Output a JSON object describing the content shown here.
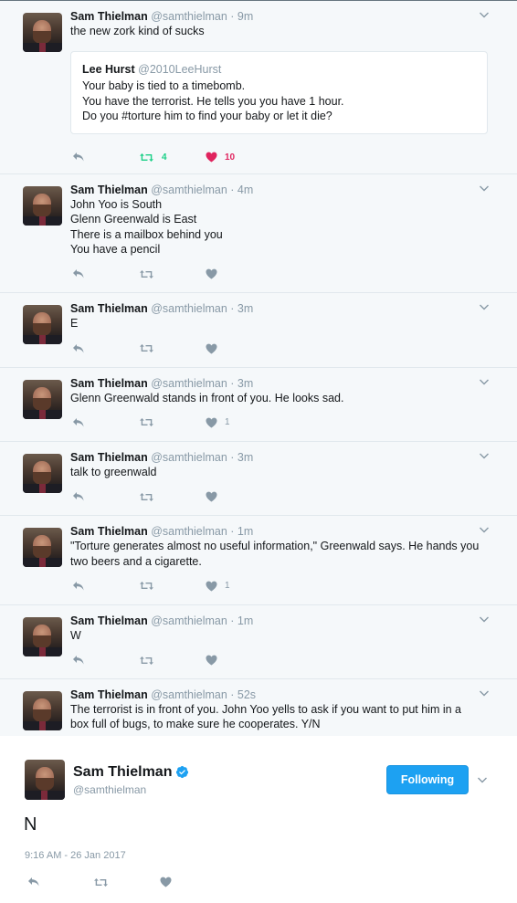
{
  "thread": [
    {
      "name": "Sam Thielman",
      "handle": "@samthielman · 9m",
      "lines": [
        "the new zork kind of sucks"
      ],
      "quote": {
        "name": "Lee Hurst",
        "handle": "@2010LeeHurst",
        "lines": [
          "Your baby is tied to a timebomb.",
          "You have the terrorist. He tells you you have 1 hour.",
          "Do you #torture him to find your baby or let it die?"
        ]
      },
      "retweets": "4",
      "likes": "10",
      "active": true
    },
    {
      "name": "Sam Thielman",
      "handle": "@samthielman · 4m",
      "lines": [
        "John Yoo is South",
        "Glenn Greenwald is East",
        "There is a mailbox behind you",
        "You have a pencil"
      ],
      "retweets": "",
      "likes": ""
    },
    {
      "name": "Sam Thielman",
      "handle": "@samthielman · 3m",
      "lines": [
        "E"
      ],
      "retweets": "",
      "likes": ""
    },
    {
      "name": "Sam Thielman",
      "handle": "@samthielman · 3m",
      "lines": [
        "Glenn Greenwald stands in front of you. He looks sad."
      ],
      "retweets": "",
      "likes": "1"
    },
    {
      "name": "Sam Thielman",
      "handle": "@samthielman · 3m",
      "lines": [
        "talk to greenwald"
      ],
      "retweets": "",
      "likes": ""
    },
    {
      "name": "Sam Thielman",
      "handle": "@samthielman · 1m",
      "lines": [
        "\"Torture generates almost no useful information,\" Greenwald says. He hands you",
        "two beers and a cigarette."
      ],
      "retweets": "",
      "likes": "1"
    },
    {
      "name": "Sam Thielman",
      "handle": "@samthielman · 1m",
      "lines": [
        "W"
      ],
      "retweets": "",
      "likes": ""
    },
    {
      "name": "Sam Thielman",
      "handle": "@samthielman · 52s",
      "lines": [
        "The terrorist is in front of you. John Yoo yells to ask if you want to put him in a",
        "box full of bugs, to make sure he cooperates. Y/N"
      ],
      "retweets": "",
      "likes": ""
    }
  ],
  "main": {
    "name": "Sam Thielman",
    "handle": "@samthielman",
    "follow_label": "Following",
    "text": "N",
    "timestamp": "9:16 AM - 26 Jan 2017"
  },
  "colors": {
    "accent": "#1da1f2",
    "retweet_active": "#19cf86",
    "like_active": "#e0245e",
    "muted": "#8899a6",
    "thread_bg": "#f5f8fa"
  },
  "icons": [
    "reply-icon",
    "retweet-icon",
    "like-icon",
    "chevron-down-icon",
    "verified-badge-icon"
  ]
}
